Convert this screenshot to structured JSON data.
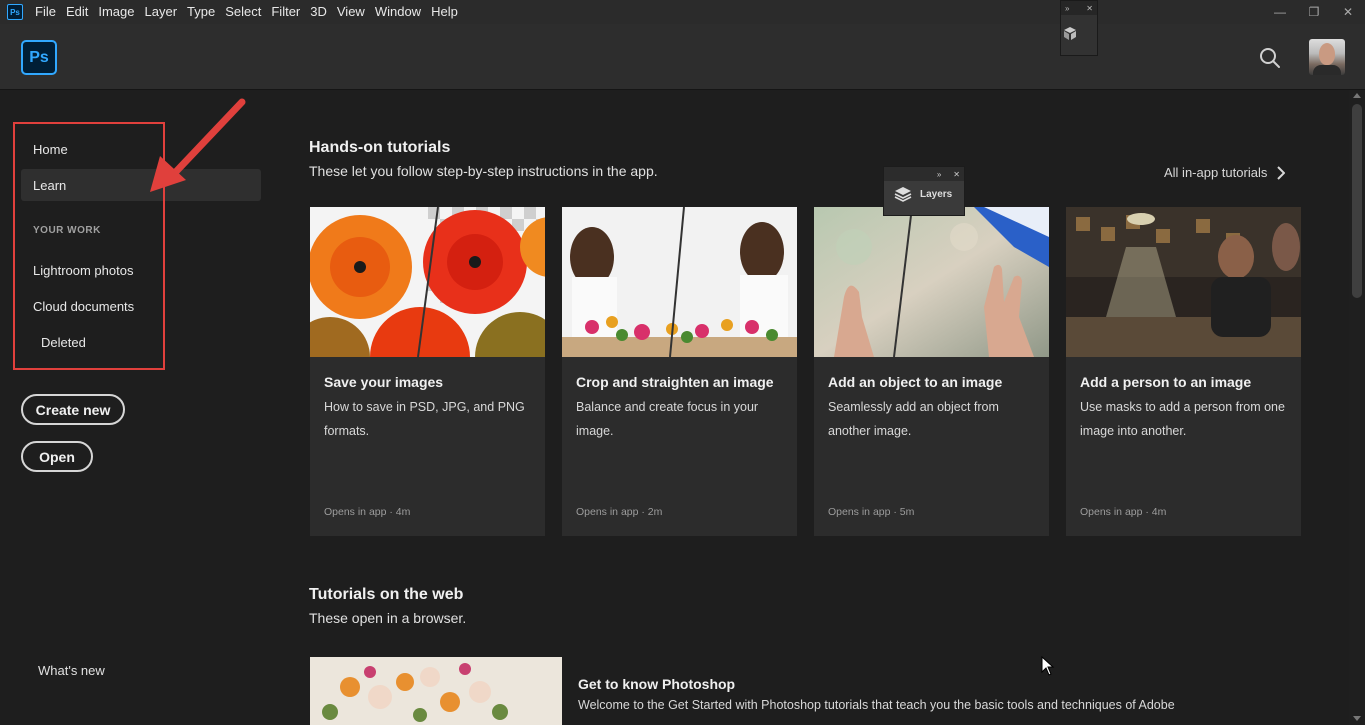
{
  "menubar": {
    "app_icon": "Ps",
    "items": [
      "File",
      "Edit",
      "Image",
      "Layer",
      "Type",
      "Select",
      "Filter",
      "3D",
      "View",
      "Window",
      "Help"
    ]
  },
  "header": {
    "logo": "Ps",
    "search_icon": "search-icon",
    "avatar": "user-avatar"
  },
  "floating_panels": {
    "layers_label": "Layers"
  },
  "sidebar": {
    "home": "Home",
    "learn": "Learn",
    "your_work_heading": "YOUR WORK",
    "lightroom": "Lightroom photos",
    "cloud_docs": "Cloud documents",
    "deleted": "Deleted",
    "create_new": "Create new",
    "open": "Open",
    "whats_new": "What's new"
  },
  "hands_on": {
    "title": "Hands-on tutorials",
    "subtitle": "These let you follow step-by-step instructions in the app.",
    "all_link": "All in-app tutorials",
    "cards": [
      {
        "title": "Save your images",
        "desc": "How to save in PSD, JPG, and PNG formats.",
        "meta": "Opens in app  ·  4m"
      },
      {
        "title": "Crop and straighten an image",
        "desc": "Balance and create focus in your image.",
        "meta": "Opens in app  ·  2m"
      },
      {
        "title": "Add an object to an image",
        "desc": "Seamlessly add an object from another image.",
        "meta": "Opens in app  ·  5m"
      },
      {
        "title": "Add a person to an image",
        "desc": "Use masks to add a person from one image into another.",
        "meta": "Opens in app  ·  4m"
      }
    ]
  },
  "web_tutorials": {
    "title": "Tutorials on the web",
    "subtitle": "These open in a browser.",
    "item_title": "Get to know Photoshop",
    "item_desc": "Welcome to the Get Started with Photoshop tutorials that teach you the basic tools and techniques of Adobe"
  },
  "colors": {
    "accent_red": "#e0403c",
    "ps_blue": "#31a8ff",
    "background": "#1e1e1e"
  }
}
